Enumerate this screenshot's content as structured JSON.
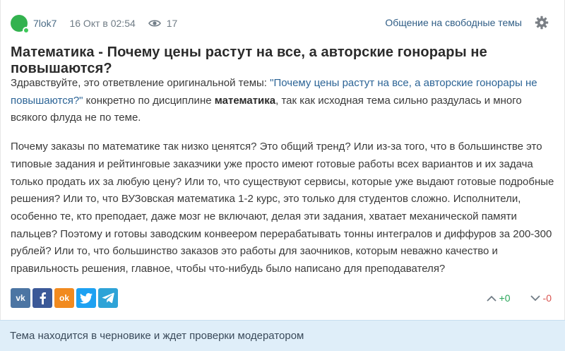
{
  "topic": {
    "author": "7lok7",
    "date": "16 Окт в 02:54",
    "views": "17",
    "category": "Общение на свободные темы",
    "title": "Математика - Почему цены растут на все, а авторские гонорары не повышаются?"
  },
  "body": {
    "p1_before": "Здравствуйте, это ответвление оригинальной темы: ",
    "p1_link": "\"Почему цены растут на все, а авторские гонорары не повышаются?\"",
    "p1_mid": " конкретно по дисциплине ",
    "p1_bold": "математика",
    "p1_after": ", так как исходная тема сильно раздулась и много всякого флуда не по теме.",
    "p2": "Почему заказы по математике так низко ценятся? Это общий тренд? Или из-за того, что в большинстве это типовые задания и рейтинговые заказчики уже просто имеют готовые работы всех вариантов и их задача только продать их за любую цену? Или то, что существуют сервисы, которые уже выдают готовые подробные решения? Или то, что ВУЗовская математика 1-2 курс, это только для студентов сложно. Исполнители, особенно те, кто преподает, даже мозг не включают, делая эти задания, хватает механической памяти пальцев? Поэтому и готовы заводским конвеером перерабатывать тонны интегралов и диффуров за 200-300 рублей? Или то, что большинство заказов это работы для заочников, которым неважно качество и правильность решения, главное, чтобы что-нибудь было написано для преподавателя?"
  },
  "share": {
    "vk": "vk",
    "ok": "ok"
  },
  "votes": {
    "plus": "+0",
    "minus": "-0"
  },
  "notice": "Тема находится в черновике и ждет проверки модератором",
  "icons": {
    "eye": "eye-icon",
    "gear": "gear-icon",
    "up": "chevron-up-icon",
    "down": "chevron-down-icon",
    "fb": "facebook-icon",
    "tw": "twitter-icon",
    "tg": "telegram-icon"
  },
  "colors": {
    "avatar": "#33b24f",
    "link": "#2c6496",
    "vote_plus": "#2aa65a",
    "vote_minus": "#d9534f",
    "notice_bg": "#dfeef9"
  }
}
